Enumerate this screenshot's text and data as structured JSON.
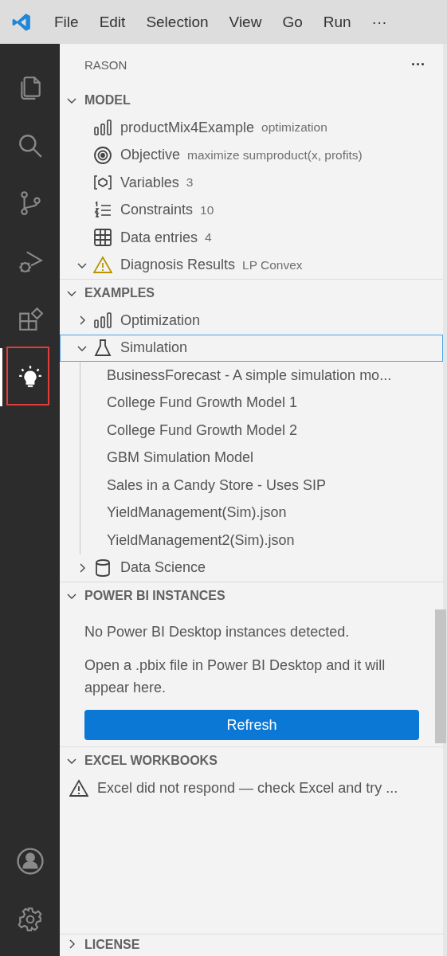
{
  "menu_bar": {
    "items": [
      "File",
      "Edit",
      "Selection",
      "View",
      "Go",
      "Run",
      "···"
    ]
  },
  "activity_bar": {
    "items": [
      {
        "kind": "files",
        "selected": false
      },
      {
        "kind": "search",
        "selected": false
      },
      {
        "kind": "source-control",
        "selected": false
      },
      {
        "kind": "run-debug",
        "selected": false
      },
      {
        "kind": "extensions",
        "selected": false
      },
      {
        "kind": "bulb",
        "selected": true,
        "highlighted": true
      }
    ],
    "bottom": [
      {
        "kind": "account"
      },
      {
        "kind": "settings"
      }
    ]
  },
  "panel": {
    "title": "RASON",
    "more": "···",
    "sections": [
      {
        "kind": "tree",
        "title": "MODEL",
        "expanded": true,
        "items": [
          {
            "kind": "chart",
            "label": "productMix4Example",
            "description": "optimization"
          },
          {
            "kind": "target",
            "label": "Objective",
            "description": "maximize sumproduct(x, profits)"
          },
          {
            "kind": "variable",
            "label": "Variables",
            "description": "3"
          },
          {
            "kind": "numbered",
            "label": "Constraints",
            "description": "10"
          },
          {
            "kind": "table",
            "label": "Data entries",
            "description": "4"
          },
          {
            "kind": "warning",
            "label": "Diagnosis Results",
            "description": "LP Convex",
            "expanded": true
          }
        ]
      },
      {
        "kind": "tree",
        "title": "EXAMPLES",
        "expanded": true,
        "items": [
          {
            "kind": "chart",
            "label": "Optimization",
            "expanded": false,
            "selected": false
          },
          {
            "kind": "flask",
            "label": "Simulation",
            "expanded": true,
            "selected": true,
            "children": [
              {
                "label": "BusinessForecast - A simple simulation mo..."
              },
              {
                "label": "College Fund Growth Model 1"
              },
              {
                "label": "College Fund Growth Model 2"
              },
              {
                "label": "GBM Simulation Model"
              },
              {
                "label": "Sales in a Candy Store - Uses SIP"
              },
              {
                "label": "YieldManagement(Sim).json"
              },
              {
                "label": "YieldManagement2(Sim).json"
              }
            ]
          },
          {
            "kind": "database",
            "label": "Data Science",
            "expanded": false,
            "selected": false
          }
        ]
      },
      {
        "kind": "message",
        "title": "POWER BI INSTANCES",
        "expanded": true,
        "paragraphs": [
          "No Power BI Desktop instances detected.",
          "Open a .pbix file in Power BI Desktop and it will appear here."
        ],
        "button": "Refresh"
      },
      {
        "kind": "warning",
        "title": "EXCEL WORKBOOKS",
        "expanded": true,
        "message": "Excel did not respond — check Excel and try ..."
      },
      {
        "kind": "collapsed",
        "title": "LICENSE",
        "expanded": false
      }
    ]
  }
}
